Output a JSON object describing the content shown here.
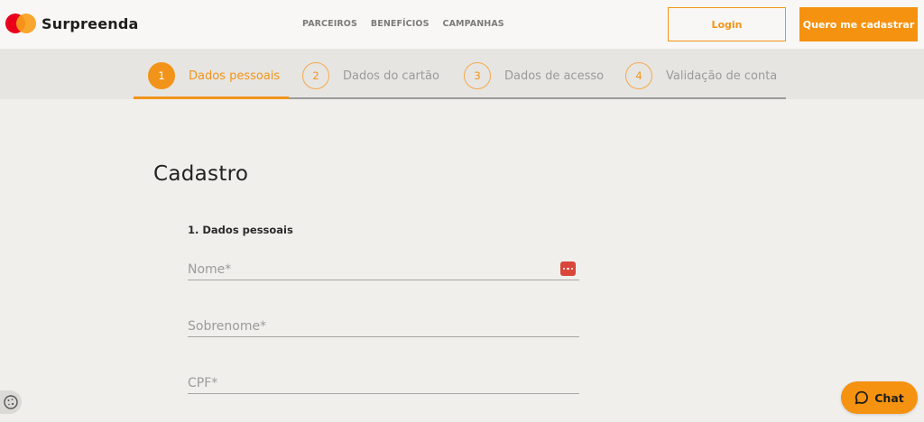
{
  "header": {
    "brand": "Surpreenda",
    "nav": [
      "PARCEIROS",
      "BENEFÍCIOS",
      "CAMPANHAS"
    ],
    "login_label": "Login",
    "signup_label": "Quero me cadastrar"
  },
  "stepper": {
    "active_step": 1,
    "steps": [
      {
        "num": "1",
        "label": "Dados pessoais"
      },
      {
        "num": "2",
        "label": "Dados do cartão"
      },
      {
        "num": "3",
        "label": "Dados de acesso"
      },
      {
        "num": "4",
        "label": "Validação de conta"
      }
    ]
  },
  "form": {
    "title": "Cadastro",
    "section_label": "1. Dados pessoais",
    "fields": [
      {
        "placeholder": "Nome*",
        "value": ""
      },
      {
        "placeholder": "Sobrenome*",
        "value": ""
      },
      {
        "placeholder": "CPF*",
        "value": ""
      }
    ]
  },
  "chat": {
    "label": "Chat"
  },
  "icons": {
    "password_manager": "password-manager-icon",
    "chat": "chat-bubble-icon",
    "cookie": "cookie-icon"
  },
  "colors": {
    "accent": "#f29419",
    "mastercard_red": "#eb001b",
    "mastercard_yellow": "#f79e1b",
    "background": "#f0efec"
  }
}
